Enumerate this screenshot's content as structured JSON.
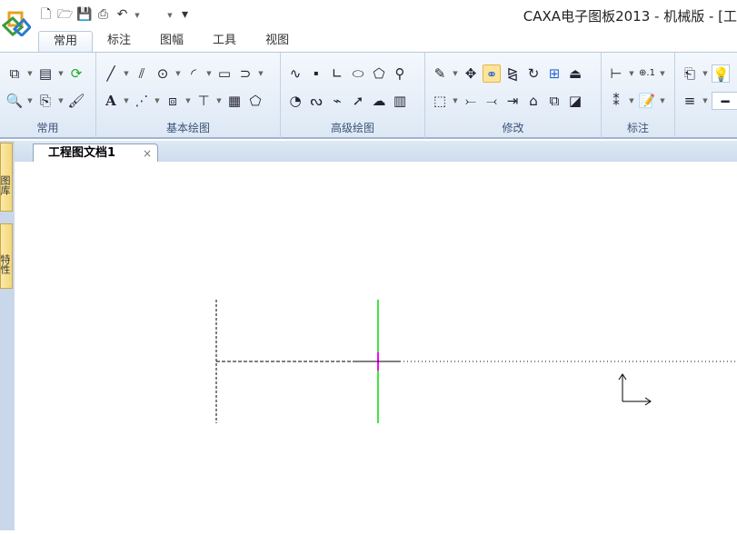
{
  "window": {
    "title": "CAXA电子图板2013 - 机械版 - [工"
  },
  "quick_access": [
    "new-icon",
    "open-icon",
    "save-icon",
    "print-icon",
    "undo-icon",
    "customize-icon"
  ],
  "tabs": [
    {
      "label": "常用"
    },
    {
      "label": "标注"
    },
    {
      "label": "图幅"
    },
    {
      "label": "工具"
    },
    {
      "label": "视图"
    }
  ],
  "ribbon_groups": [
    {
      "label": "常用"
    },
    {
      "label": "基本绘图"
    },
    {
      "label": "高级绘图"
    },
    {
      "label": "修改"
    },
    {
      "label": "标注"
    }
  ],
  "side_panels": [
    {
      "label": "图库"
    },
    {
      "label": "特性"
    }
  ],
  "document_tab": {
    "label": "工程图文档1",
    "close": "×"
  },
  "colors": {
    "ribbon": "#dde8f5",
    "green_axis": "#00dd00",
    "magenta": "#ff00ff"
  }
}
